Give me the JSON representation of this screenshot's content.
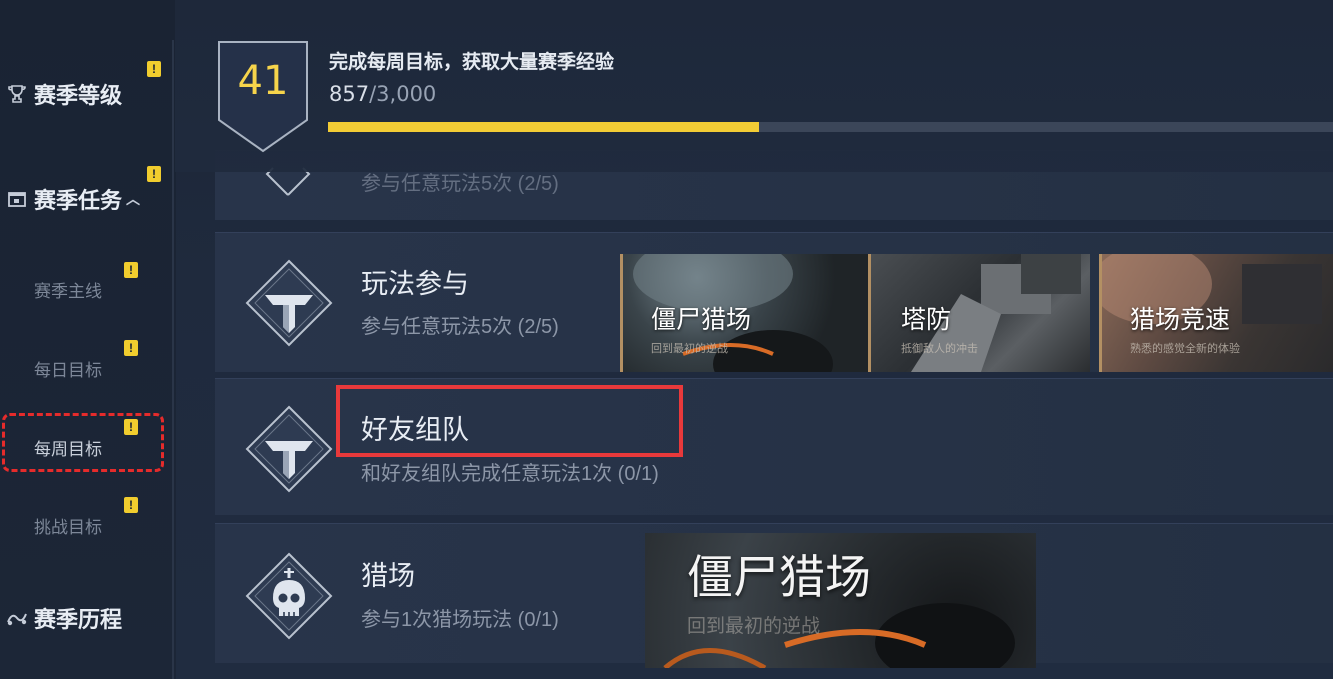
{
  "sidebar": {
    "items": [
      {
        "label": "赛季等级",
        "icon": "trophy-icon",
        "badge": "!"
      },
      {
        "label": "赛季任务",
        "icon": "calendar-icon",
        "badge": "!",
        "expanded_icon": "chevron-up-icon"
      },
      {
        "label": "赛季主线",
        "badge": "!"
      },
      {
        "label": "每日目标",
        "badge": "!"
      },
      {
        "label": "每周目标",
        "badge": "!",
        "selected": true
      },
      {
        "label": "挑战目标",
        "badge": "!"
      },
      {
        "label": "赛季历程",
        "icon": "journey-icon"
      }
    ]
  },
  "header": {
    "level": "41",
    "title": "完成每周目标，获取大量赛季经验",
    "progress_current": "857",
    "progress_total": "/3,000",
    "progress_fraction": 0.2857
  },
  "tasks": [
    {
      "title": "",
      "desc": "参与任意玩法5次 (2/5)",
      "icon": "mode-emblem-icon"
    },
    {
      "title": "玩法参与",
      "desc": "参与任意玩法5次 (2/5)",
      "icon": "mode-emblem-icon"
    },
    {
      "title": "好友组队",
      "desc": "和好友组队完成任意玩法1次 (0/1)",
      "icon": "mode-emblem-icon"
    },
    {
      "title": "猎场",
      "desc": "参与1次猎场玩法 (0/1)",
      "icon": "skull-icon"
    }
  ],
  "modes": [
    {
      "name": "僵尸猎场",
      "sub": "回到最初的逆战"
    },
    {
      "name": "塔防",
      "sub": "抵御敌人的冲击"
    },
    {
      "name": "猎场竞速",
      "sub": "熟悉的感觉全新的体验"
    }
  ],
  "preview": {
    "name": "僵尸猎场",
    "sub": "回到最初的逆战"
  },
  "colors": {
    "accent": "#f2cc35",
    "badge": "#f1cd2e",
    "highlight": "#e8393b"
  }
}
